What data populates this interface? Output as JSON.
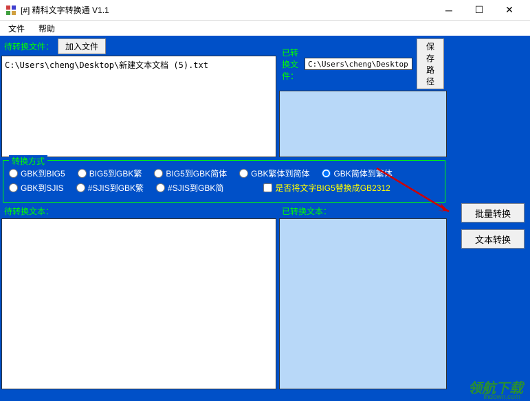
{
  "titlebar": {
    "title": "[#] 精科文字转换通 V1.1"
  },
  "menubar": {
    "file": "文件",
    "help": "帮助"
  },
  "panes": {
    "pending_files_label": "待转换文件：",
    "add_file_btn": "加入文件",
    "file_list": "C:\\Users\\cheng\\Desktop\\新建文本文档 (5).txt",
    "done_files_label": "已转换文件：",
    "path_value": "C:\\Users\\cheng\\Desktop",
    "save_path_btn": "保存路径"
  },
  "convert": {
    "group_title": "转换方式",
    "r1": "GBK到BIG5",
    "r2": "BIG5到GBK繁",
    "r3": "BIG5到GBK简体",
    "r4": "GBK繁体到简体",
    "r5": "GBK简体到繁体",
    "r6": "GBK到SJIS",
    "r7": "#SJIS到GBK繁",
    "r8": "#SJIS到GBK简",
    "cb": "是否将文字BIG5替换成GB2312"
  },
  "text_panes": {
    "pending_text_label": "待转换文本：",
    "done_text_label": "已转换文本："
  },
  "buttons": {
    "batch": "批量转换",
    "text": "文本转换"
  },
  "watermark": {
    "main": "领航下载",
    "sub": "lhdown.com"
  }
}
